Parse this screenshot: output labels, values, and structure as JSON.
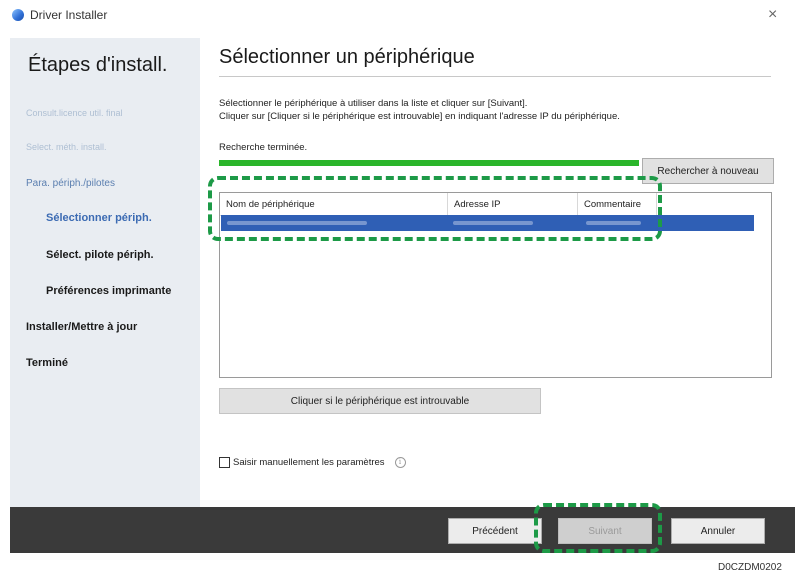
{
  "window": {
    "title": "Driver Installer",
    "close_glyph": "×"
  },
  "sidebar": {
    "title": "Étapes d'install.",
    "steps": [
      {
        "label": "Consult.licence util. final",
        "state": "done"
      },
      {
        "label": "Select. méth. install.",
        "state": "done"
      },
      {
        "label": "Para. périph./pilotes",
        "state": "active-parent"
      },
      {
        "label": "Sélectionner périph.",
        "state": "current"
      },
      {
        "label": "Sélect. pilote périph.",
        "state": "pending"
      },
      {
        "label": "Préférences imprimante",
        "state": "pending"
      },
      {
        "label": "Installer/Mettre à jour",
        "state": "pending"
      },
      {
        "label": "Terminé",
        "state": "pending"
      }
    ]
  },
  "main": {
    "title": "Sélectionner un périphérique",
    "instruction_1": "Sélectionner le périphérique à utiliser dans la liste et cliquer sur [Suivant].",
    "instruction_2": "Cliquer sur [Cliquer si le périphérique est introuvable] en indiquant l'adresse IP du périphérique.",
    "status": "Recherche terminée.",
    "progress_percent": 100,
    "research_button": "Rechercher à nouveau",
    "columns": [
      "Nom de périphérique",
      "Adresse IP",
      "Commentaire"
    ],
    "not_found_button": "Cliquer si le périphérique est introuvable",
    "manual_label": "Saisir manuellement les paramètres",
    "manual_checked": false,
    "info_glyph": "i"
  },
  "footer": {
    "previous": "Précédent",
    "next": "Suivant",
    "cancel": "Annuler"
  },
  "doc_code": "D0CZDM0202",
  "colors": {
    "accent": "#2f5fb5",
    "progress": "#2ab52a",
    "highlight": "#1d9a47",
    "footer": "#3a3a3a"
  }
}
